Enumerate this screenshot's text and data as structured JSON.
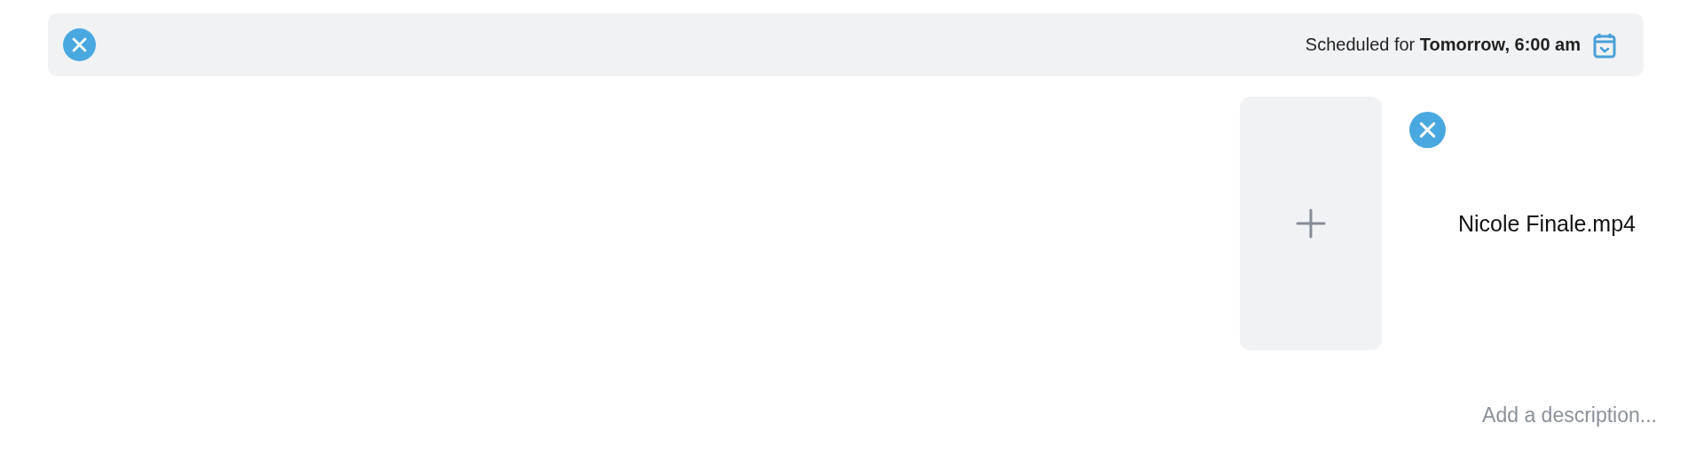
{
  "schedule": {
    "text": "Scheduled for **Tomorrow, 6:00 am**"
  },
  "attachment": {
    "file_name": "Nicole Finale.mp4"
  },
  "description": {
    "placeholder": "Add a description..."
  }
}
